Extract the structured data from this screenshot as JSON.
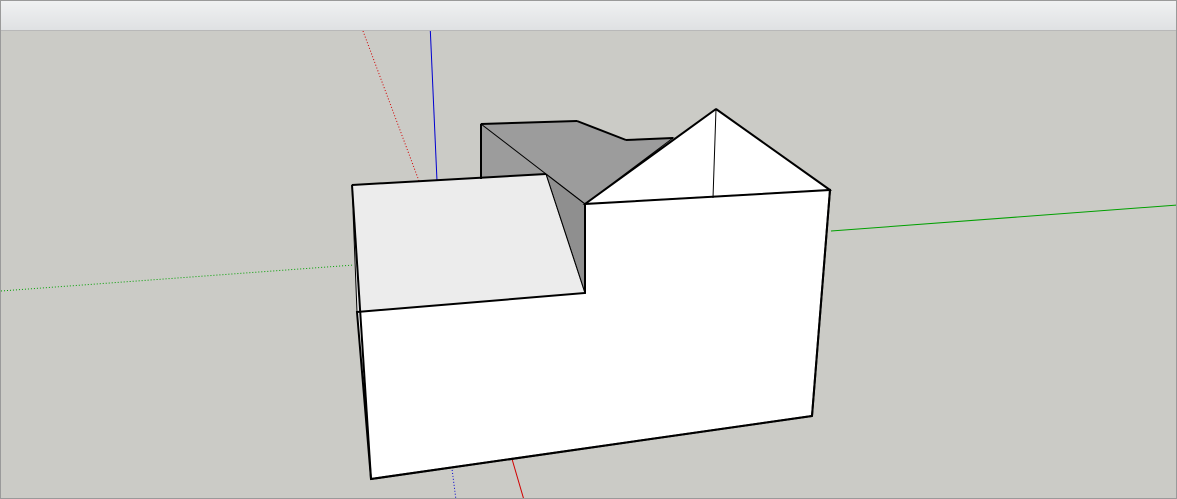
{
  "app": {
    "background_color": "#cbcbc6",
    "toolbar_color": "#e6e7e9"
  },
  "viewport": {
    "view": "perspective",
    "axes": {
      "red": "#d10000",
      "green": "#00a000",
      "blue": "#0000d0"
    },
    "model": {
      "type": "house-shape",
      "face_colors": {
        "wall": "#ffffff",
        "roof_light": "#ececec",
        "roof_shadow": "#9c9c9c",
        "edge": "#000000"
      }
    }
  }
}
